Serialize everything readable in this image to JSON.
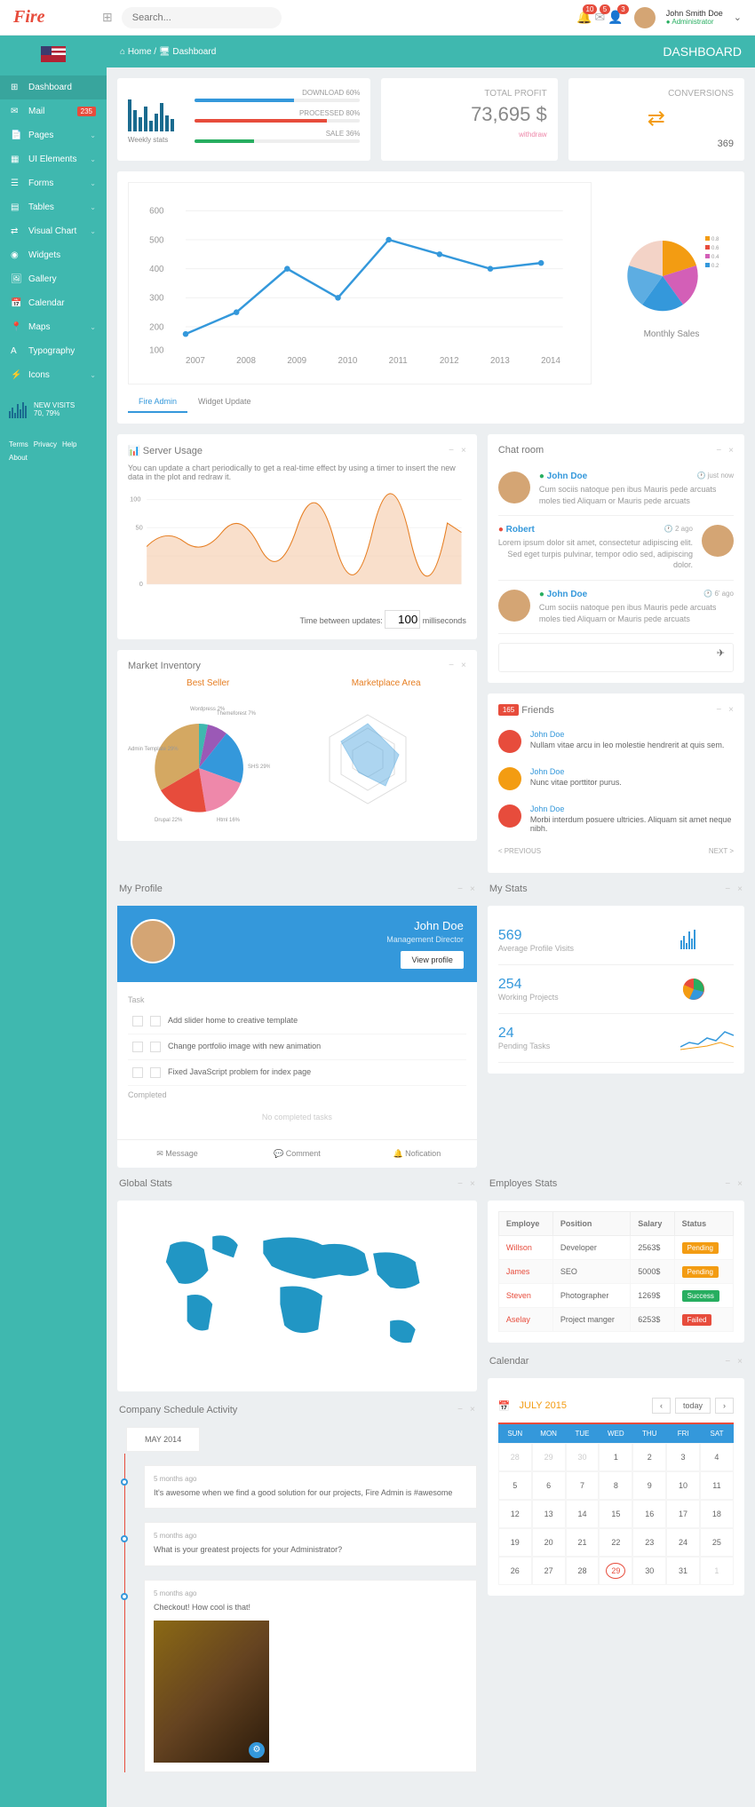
{
  "topbar": {
    "logo": "Fire",
    "search_placeholder": "Search...",
    "notifs": [
      {
        "icon": "🔔",
        "count": 10
      },
      {
        "icon": "✉",
        "count": 5
      },
      {
        "icon": "👤",
        "count": 3
      }
    ],
    "user_name": "John Smith Doe",
    "user_role": "Administrator"
  },
  "sidebar": {
    "nav": [
      {
        "icon": "⊞",
        "label": "Dashboard",
        "active": true
      },
      {
        "icon": "✉",
        "label": "Mail",
        "badge": "235"
      },
      {
        "icon": "📄",
        "label": "Pages",
        "chevron": true
      },
      {
        "icon": "▦",
        "label": "UI Elements",
        "chevron": true
      },
      {
        "icon": "☰",
        "label": "Forms",
        "chevron": true
      },
      {
        "icon": "▤",
        "label": "Tables",
        "chevron": true
      },
      {
        "icon": "⇄",
        "label": "Visual Chart",
        "chevron": true
      },
      {
        "icon": "◉",
        "label": "Widgets"
      },
      {
        "icon": "🖼",
        "label": "Gallery"
      },
      {
        "icon": "📅",
        "label": "Calendar"
      },
      {
        "icon": "📍",
        "label": "Maps",
        "chevron": true
      },
      {
        "icon": "A",
        "label": "Typography"
      },
      {
        "icon": "⚡",
        "label": "Icons",
        "chevron": true
      }
    ],
    "stats_title": "NEW VISITS",
    "stats_value": "70, 79%",
    "links": [
      "Terms",
      "Privacy",
      "Help",
      "About"
    ]
  },
  "breadcrumb": {
    "home": "Home",
    "page": "Dashboard",
    "title": "DASHBOARD"
  },
  "weekly": {
    "label": "Weekly stats",
    "progress": [
      {
        "label": "DOWNLOAD 60%",
        "pct": 60,
        "color": "#3498db"
      },
      {
        "label": "PROCESSED 80%",
        "pct": 80,
        "color": "#e74c3c"
      },
      {
        "label": "SALE 36%",
        "pct": 36,
        "color": "#27ae60"
      }
    ]
  },
  "total_profit": {
    "label": "TOTAL PROFIT",
    "value": "73,695 $",
    "sub": "withdraw"
  },
  "conversions": {
    "label": "CONVERSIONS",
    "value": "369"
  },
  "chart_data": {
    "line_main": {
      "type": "line",
      "x": [
        2007,
        2008,
        2009,
        2010,
        2011,
        2012,
        2013,
        2014
      ],
      "y": [
        180,
        250,
        400,
        300,
        500,
        450,
        400,
        420
      ],
      "ylim": [
        100,
        600
      ]
    },
    "pie_monthly": {
      "type": "pie",
      "title": "Monthly Sales",
      "legend": [
        "0.8",
        "0.6",
        "0.4",
        "0.2"
      ],
      "slices": [
        {
          "value": 25,
          "color": "#f39c12"
        },
        {
          "value": 20,
          "color": "#e74c3c"
        },
        {
          "value": 15,
          "color": "#d35fb7"
        },
        {
          "value": 20,
          "color": "#3498db"
        },
        {
          "value": 20,
          "color": "#5dade2"
        }
      ]
    },
    "server_usage": {
      "type": "area",
      "title": "Server Usage",
      "desc": "You can update a chart periodically to get a real-time effect by using a timer to insert the new data in the plot and redraw it.",
      "ylim": [
        0,
        100
      ],
      "update_label": "Time between updates:",
      "update_value": "100",
      "update_unit": "milliseconds"
    },
    "best_seller": {
      "type": "pie",
      "title": "Best Seller",
      "slices": [
        {
          "name": "Wordpress",
          "value": 2,
          "color": "#3fb8af"
        },
        {
          "name": "Themeforest",
          "value": 7,
          "color": "#9b59b6"
        },
        {
          "name": "SHS",
          "value": 29,
          "color": "#3498db"
        },
        {
          "name": "Html",
          "value": 16,
          "color": "#e8a"
        },
        {
          "name": "Drupal",
          "value": 22,
          "color": "#e74c3c"
        },
        {
          "name": "Admin Template",
          "value": 29,
          "color": "#d4a862"
        }
      ]
    },
    "marketplace": {
      "type": "radar",
      "title": "Marketplace Area"
    }
  },
  "tabs": [
    "Fire Admin",
    "Widget Update"
  ],
  "market_inventory": {
    "title": "Market Inventory"
  },
  "chat": {
    "title": "Chat room",
    "items": [
      {
        "name": "John Doe",
        "status": "green",
        "time": "just now",
        "text": "Cum sociis natoque pen ibus Mauris pede arcuats moles tied Aliquam or Mauris pede arcuats",
        "side": "left"
      },
      {
        "name": "Robert",
        "status": "red",
        "time": "2 ago",
        "text": "Lorem ipsum dolor sit amet, consectetur adipiscing elit. Sed eget turpis pulvinar, tempor odio sed, adipiscing dolor.",
        "side": "right"
      },
      {
        "name": "John Doe",
        "status": "green",
        "time": "6' ago",
        "text": "Cum sociis natoque pen ibus Mauris pede arcuats moles tied Aliquam or Mauris pede arcuats",
        "side": "left"
      }
    ]
  },
  "friends": {
    "title": "Friends",
    "count": "165",
    "items": [
      {
        "name": "John Doe",
        "text": "Nullam vitae arcu in leo molestie hendrerit at quis sem.",
        "color": "#e74c3c"
      },
      {
        "name": "John Doe",
        "text": "Nunc vitae porttitor purus.",
        "color": "#f39c12"
      },
      {
        "name": "John Doe",
        "text": "Morbi interdum posuere ultricies. Aliquam sit amet neque nibh.",
        "color": "#e74c3c"
      }
    ],
    "prev": "< PREVIOUS",
    "next": "NEXT >"
  },
  "profile": {
    "title": "My Profile",
    "name": "John Doe",
    "role": "Management Director",
    "btn": "View profile",
    "task_header": "Task",
    "tasks": [
      "Add slider home to creative template",
      "Change portfolio image with new animation",
      "Fixed JavaScript problem for index page"
    ],
    "completed": "Completed",
    "none": "No completed tasks",
    "actions": [
      "✉ Message",
      "💬 Comment",
      "🔔 Nofication"
    ]
  },
  "mystats": {
    "title": "My Stats",
    "items": [
      {
        "num": "569",
        "desc": "Average Profile Visits",
        "chart": "bars"
      },
      {
        "num": "254",
        "desc": "Working Projects",
        "chart": "pie"
      },
      {
        "num": "24",
        "desc": "Pending Tasks",
        "chart": "line"
      }
    ]
  },
  "global_stats": {
    "title": "Global Stats"
  },
  "employees": {
    "title": "Employes Stats",
    "headers": [
      "Employe",
      "Position",
      "Salary",
      "Status"
    ],
    "rows": [
      {
        "name": "Willson",
        "pos": "Developer",
        "salary": "2563$",
        "status": "Pending",
        "cls": "st-pending"
      },
      {
        "name": "James",
        "pos": "SEO",
        "salary": "5000$",
        "status": "Pending",
        "cls": "st-pending"
      },
      {
        "name": "Steven",
        "pos": "Photographer",
        "salary": "1269$",
        "status": "Success",
        "cls": "st-success"
      },
      {
        "name": "Aselay",
        "pos": "Project manger",
        "salary": "6253$",
        "status": "Failed",
        "cls": "st-failed"
      }
    ]
  },
  "calendar": {
    "title": "Calendar",
    "month": "JULY 2015",
    "today": "today",
    "days": [
      "SUN",
      "MON",
      "TUE",
      "WED",
      "THU",
      "FRI",
      "SAT"
    ],
    "cells": [
      {
        "d": 28,
        "o": 1
      },
      {
        "d": 29,
        "o": 1
      },
      {
        "d": 30,
        "o": 1
      },
      {
        "d": 1
      },
      {
        "d": 2
      },
      {
        "d": 3
      },
      {
        "d": 4
      },
      {
        "d": 5
      },
      {
        "d": 6
      },
      {
        "d": 7
      },
      {
        "d": 8
      },
      {
        "d": 9
      },
      {
        "d": 10
      },
      {
        "d": 11
      },
      {
        "d": 12
      },
      {
        "d": 13
      },
      {
        "d": 14
      },
      {
        "d": 15
      },
      {
        "d": 16
      },
      {
        "d": 17
      },
      {
        "d": 18
      },
      {
        "d": 19
      },
      {
        "d": 20
      },
      {
        "d": 21
      },
      {
        "d": 22
      },
      {
        "d": 23
      },
      {
        "d": 24
      },
      {
        "d": 25
      },
      {
        "d": 26
      },
      {
        "d": 27
      },
      {
        "d": 28
      },
      {
        "d": 29,
        "t": 1
      },
      {
        "d": 30
      },
      {
        "d": 31
      },
      {
        "d": 1,
        "o": 1
      }
    ]
  },
  "schedule": {
    "title": "Company Schedule Activity",
    "period": "MAY 2014",
    "items": [
      {
        "time": "5 months ago",
        "text": "It's awesome when we find a good solution for our projects, Fire Admin is #awesome"
      },
      {
        "time": "5 months ago",
        "text": "What is your greatest projects for your Administrator?"
      },
      {
        "time": "5 months ago",
        "text": "Checkout! How cool is that!",
        "img": true
      }
    ]
  }
}
